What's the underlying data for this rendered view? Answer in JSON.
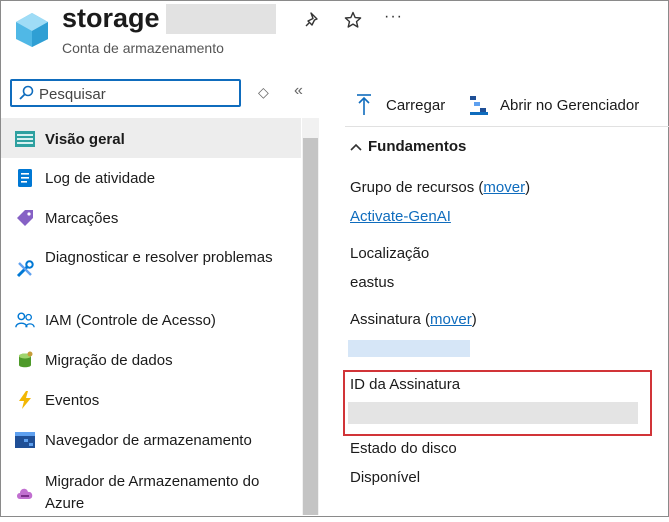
{
  "header": {
    "title": "storage",
    "subtitle": "Conta de armazenamento",
    "pin_icon": "pin-icon",
    "favorite_icon": "star-icon",
    "more_label": "···"
  },
  "sidebar": {
    "search": {
      "placeholder": "Pesquisar",
      "value": ""
    },
    "sort_label": "◇",
    "collapse_label": "«",
    "items": [
      {
        "label": "Visão geral",
        "icon": "overview-icon",
        "active": true
      },
      {
        "label": "Log de atividade",
        "icon": "activity-log-icon"
      },
      {
        "label": "Marcações",
        "icon": "tag-icon"
      },
      {
        "label": "Diagnosticar e resolver problemas",
        "icon": "wrench-icon"
      },
      {
        "label": "IAM (Controle de Acesso)",
        "icon": "people-icon"
      },
      {
        "label": "Migração de dados",
        "icon": "migration-icon"
      },
      {
        "label": "Eventos",
        "icon": "lightning-icon"
      },
      {
        "label": "Navegador de armazenamento",
        "icon": "storage-browser-icon"
      },
      {
        "label": "Migrador de Armazenamento do Azure",
        "icon": "cloud-migrator-icon"
      }
    ]
  },
  "toolbar": {
    "upload_label": "Carregar",
    "open_explorer_label": "Abrir no Gerenciador"
  },
  "essentials": {
    "section_title": "Fundamentos",
    "resource_group_label": "Grupo de recursos",
    "move_link": "mover",
    "resource_group_value": "Activate-GenAI",
    "location_label": "Localização",
    "location_value": "eastus",
    "subscription_label": "Assinatura",
    "subscription_id_label": "ID da Assinatura",
    "disk_state_label": "Estado do disco",
    "disk_state_value": "Disponível"
  },
  "colors": {
    "accent": "#0f6cbd",
    "highlight_border": "#d13438",
    "active_nav_bg": "#ededed"
  }
}
